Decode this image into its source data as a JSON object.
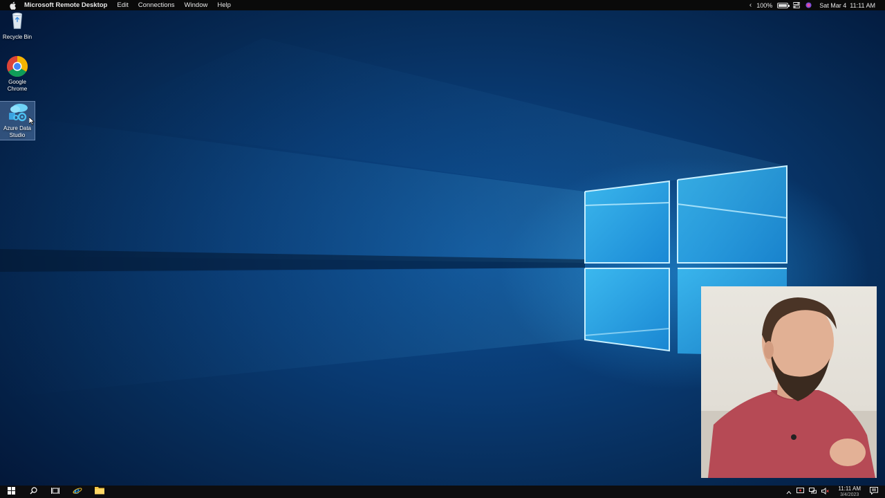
{
  "menubar": {
    "app_name": "Microsoft Remote Desktop",
    "items": [
      "Edit",
      "Connections",
      "Window",
      "Help"
    ],
    "battery_percent": "100%",
    "datetime": "Sat Mar 4  11:11 AM"
  },
  "desktop": {
    "icons": [
      {
        "label": "Recycle Bin",
        "icon": "recycle-bin-icon"
      },
      {
        "label": "Google Chrome",
        "icon": "chrome-icon"
      },
      {
        "label": "Azure Data Studio",
        "icon": "azure-data-studio-icon",
        "selected": true
      }
    ]
  },
  "taskbar": {
    "buttons": [
      "start-icon",
      "search-icon",
      "task-view-icon",
      "internet-explorer-icon",
      "file-explorer-icon"
    ],
    "tray_time": "11:11 AM",
    "tray_date": "3/4/2023"
  },
  "colors": {
    "wallpaper_dark": "#03183a",
    "wallpaper_mid": "#0b4d92",
    "window_glow": "#2aa6ee",
    "taskbar": "#0d0d0f",
    "menubar": "#0a0a0a"
  }
}
